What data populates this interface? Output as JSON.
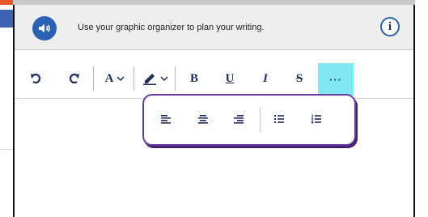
{
  "header": {
    "instruction": "Use your graphic organizer to plan your writing.",
    "speaker_icon": "speaker-icon",
    "info_label": "i"
  },
  "toolbar": {
    "undo_icon": "undo-icon",
    "redo_icon": "redo-icon",
    "font_color_label": "A",
    "highlight_icon": "highlighter-icon",
    "bold_label": "B",
    "underline_label": "U",
    "italic_label": "I",
    "strike_label": "S",
    "more_label": "···"
  },
  "popover": {
    "icons": [
      "align-left-icon",
      "align-center-icon",
      "align-right-icon",
      "bulleted-list-icon",
      "numbered-list-icon"
    ]
  },
  "colors": {
    "accent_blue": "#2a61b5",
    "active_cyan": "#7fe8f2",
    "popover_border": "#6c3aa0"
  }
}
